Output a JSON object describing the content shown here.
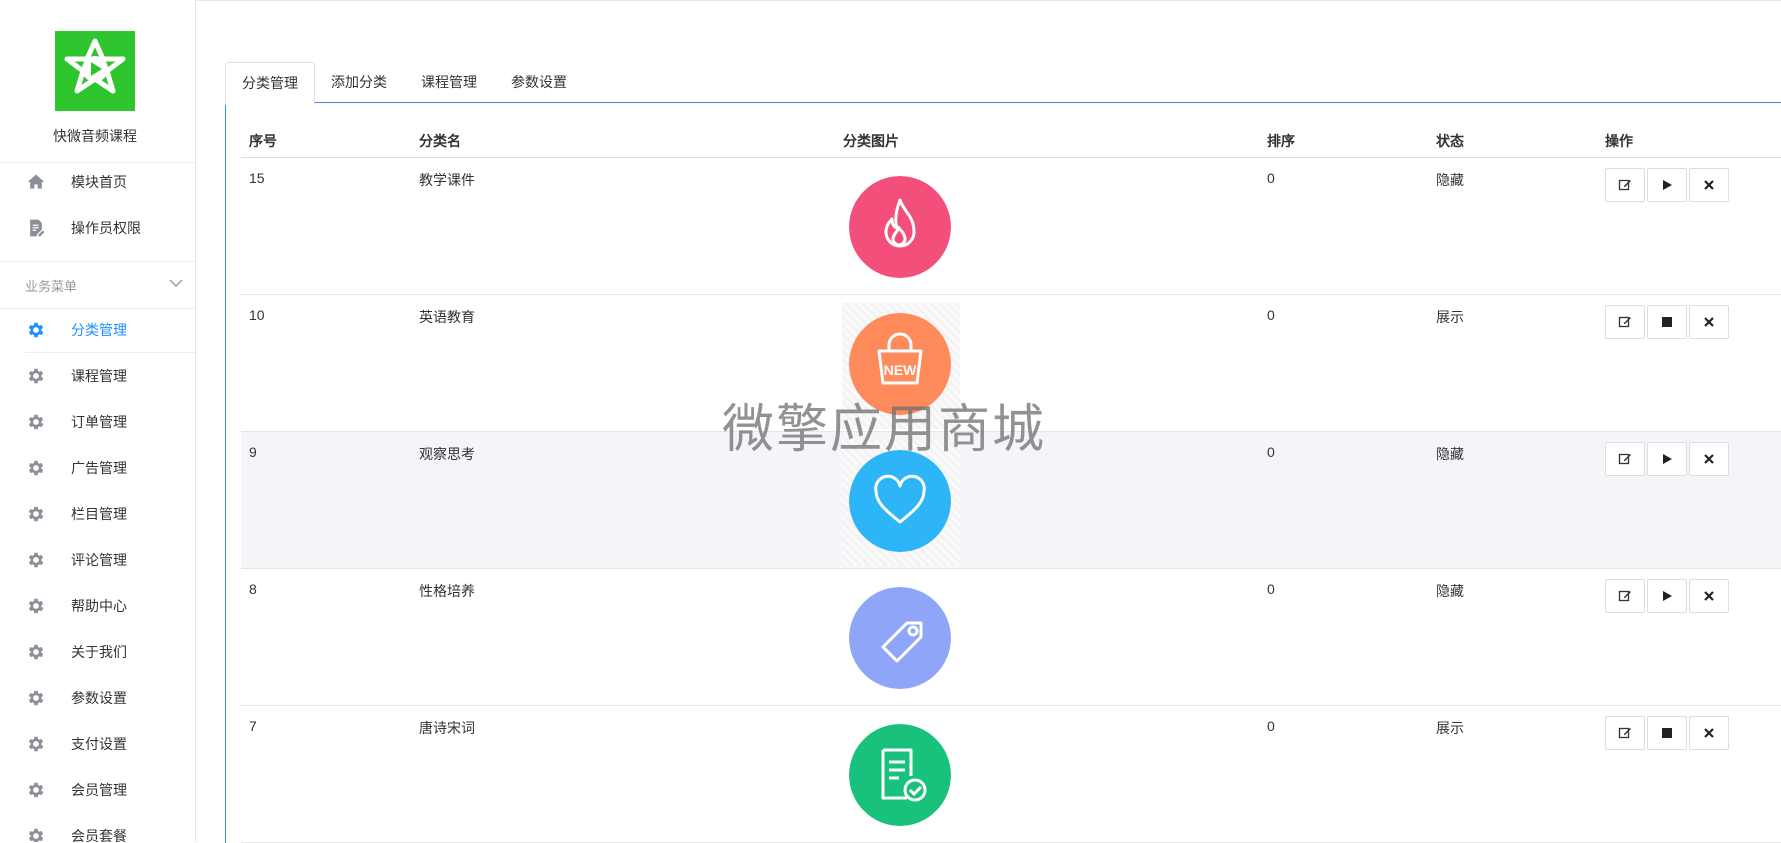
{
  "brand": {
    "title": "快微音频课程"
  },
  "top_menu": [
    {
      "label": "模块首页",
      "icon": "home-icon"
    },
    {
      "label": "操作员权限",
      "icon": "document-edit-icon"
    }
  ],
  "section": {
    "label": "业务菜单"
  },
  "business_menu": [
    {
      "label": "分类管理",
      "icon": "gear-icon",
      "active": true
    },
    {
      "label": "课程管理",
      "icon": "gear-icon"
    },
    {
      "label": "订单管理",
      "icon": "gear-icon"
    },
    {
      "label": "广告管理",
      "icon": "gear-icon"
    },
    {
      "label": "栏目管理",
      "icon": "gear-icon"
    },
    {
      "label": "评论管理",
      "icon": "gear-icon"
    },
    {
      "label": "帮助中心",
      "icon": "gear-icon"
    },
    {
      "label": "关于我们",
      "icon": "gear-icon"
    },
    {
      "label": "参数设置",
      "icon": "gear-icon"
    },
    {
      "label": "支付设置",
      "icon": "gear-icon"
    },
    {
      "label": "会员管理",
      "icon": "gear-icon"
    },
    {
      "label": "会员套餐",
      "icon": "gear-icon"
    }
  ],
  "tabs": [
    {
      "label": "分类管理",
      "active": true
    },
    {
      "label": "添加分类"
    },
    {
      "label": "课程管理"
    },
    {
      "label": "参数设置"
    }
  ],
  "table": {
    "headers": [
      "序号",
      "分类名",
      "分类图片",
      "排序",
      "状态",
      "操作"
    ],
    "rows": [
      {
        "id": "15",
        "name": "教学课件",
        "sort": "0",
        "status": "隐藏",
        "image": "fire-icon",
        "color": "#f2507a",
        "toggle": "play-icon"
      },
      {
        "id": "10",
        "name": "英语教育",
        "sort": "0",
        "status": "展示",
        "image": "new-bag-icon",
        "color": "#ff8a5c",
        "toggle": "stop-icon"
      },
      {
        "id": "9",
        "name": "观察思考",
        "sort": "0",
        "status": "隐藏",
        "image": "heart-icon",
        "color": "#2eb5f8",
        "toggle": "play-icon"
      },
      {
        "id": "8",
        "name": "性格培养",
        "sort": "0",
        "status": "隐藏",
        "image": "tag-icon",
        "color": "#8fa6f8",
        "toggle": "play-icon"
      },
      {
        "id": "7",
        "name": "唐诗宋词",
        "sort": "0",
        "status": "展示",
        "image": "document-check-icon",
        "color": "#18c17c",
        "toggle": "stop-icon"
      }
    ]
  },
  "watermark": "微擎应用商城"
}
